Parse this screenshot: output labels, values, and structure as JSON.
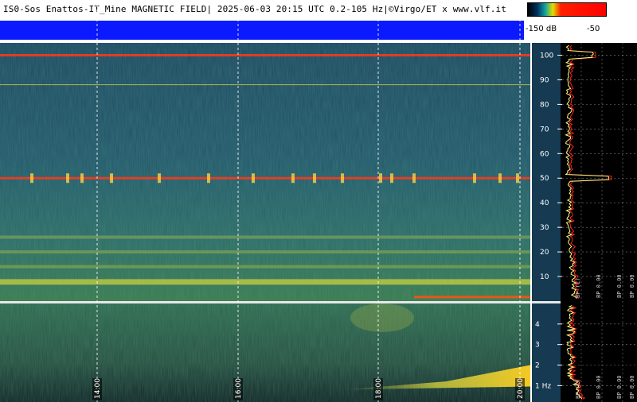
{
  "header": {
    "title": "IS0-Sos Enattos-IT_Mine MAGNETIC FIELD| 2025-06-03 20:15 UTC 0.2-105 Hz|©Virgo/ET x www.vlf.it"
  },
  "colorbar": {
    "min_label": "-150 dB",
    "max_label": "-50"
  },
  "colors": {
    "header_blue": "#0b19ff",
    "spectrogram_base": "#1d4a5a",
    "mains_line": "#ff3a1a",
    "spectrum_trace": "#ff2020",
    "average_trace": "#ffff80"
  },
  "chart_data": [
    {
      "type": "heatmap",
      "title": "",
      "ylabel": "",
      "xlabel": "",
      "x_ticks": [
        "14:00",
        "16:00",
        "18:00",
        "20:00"
      ],
      "y_ticks": [
        "10",
        "20",
        "30",
        "40",
        "50",
        "60",
        "70",
        "80",
        "90",
        "100"
      ],
      "ylim": [
        0,
        105
      ],
      "features": {
        "strong_line_hz": [
          50,
          100
        ],
        "marker_line_hz": 88,
        "bands_hz": [
          7.8,
          14,
          20,
          26
        ]
      }
    },
    {
      "type": "heatmap",
      "title": "",
      "x_ticks": [
        "14:00",
        "16:00",
        "18:00",
        "20:00"
      ],
      "y_ticks": [
        "1 Hz",
        "2",
        "3",
        "4"
      ],
      "ylim": [
        0.2,
        5
      ],
      "features": {
        "evening_signal_hz": [
          0.8,
          2.0
        ]
      }
    },
    {
      "type": "line",
      "rotated_labels_upper": [
        "BP (C)",
        "BP 0.00",
        "BP 0.00",
        "BP 0.00"
      ],
      "rotated_labels_lower": [
        "BP (C)",
        "BP 0.00",
        "BP 0.00",
        "BP 0.00"
      ]
    }
  ]
}
